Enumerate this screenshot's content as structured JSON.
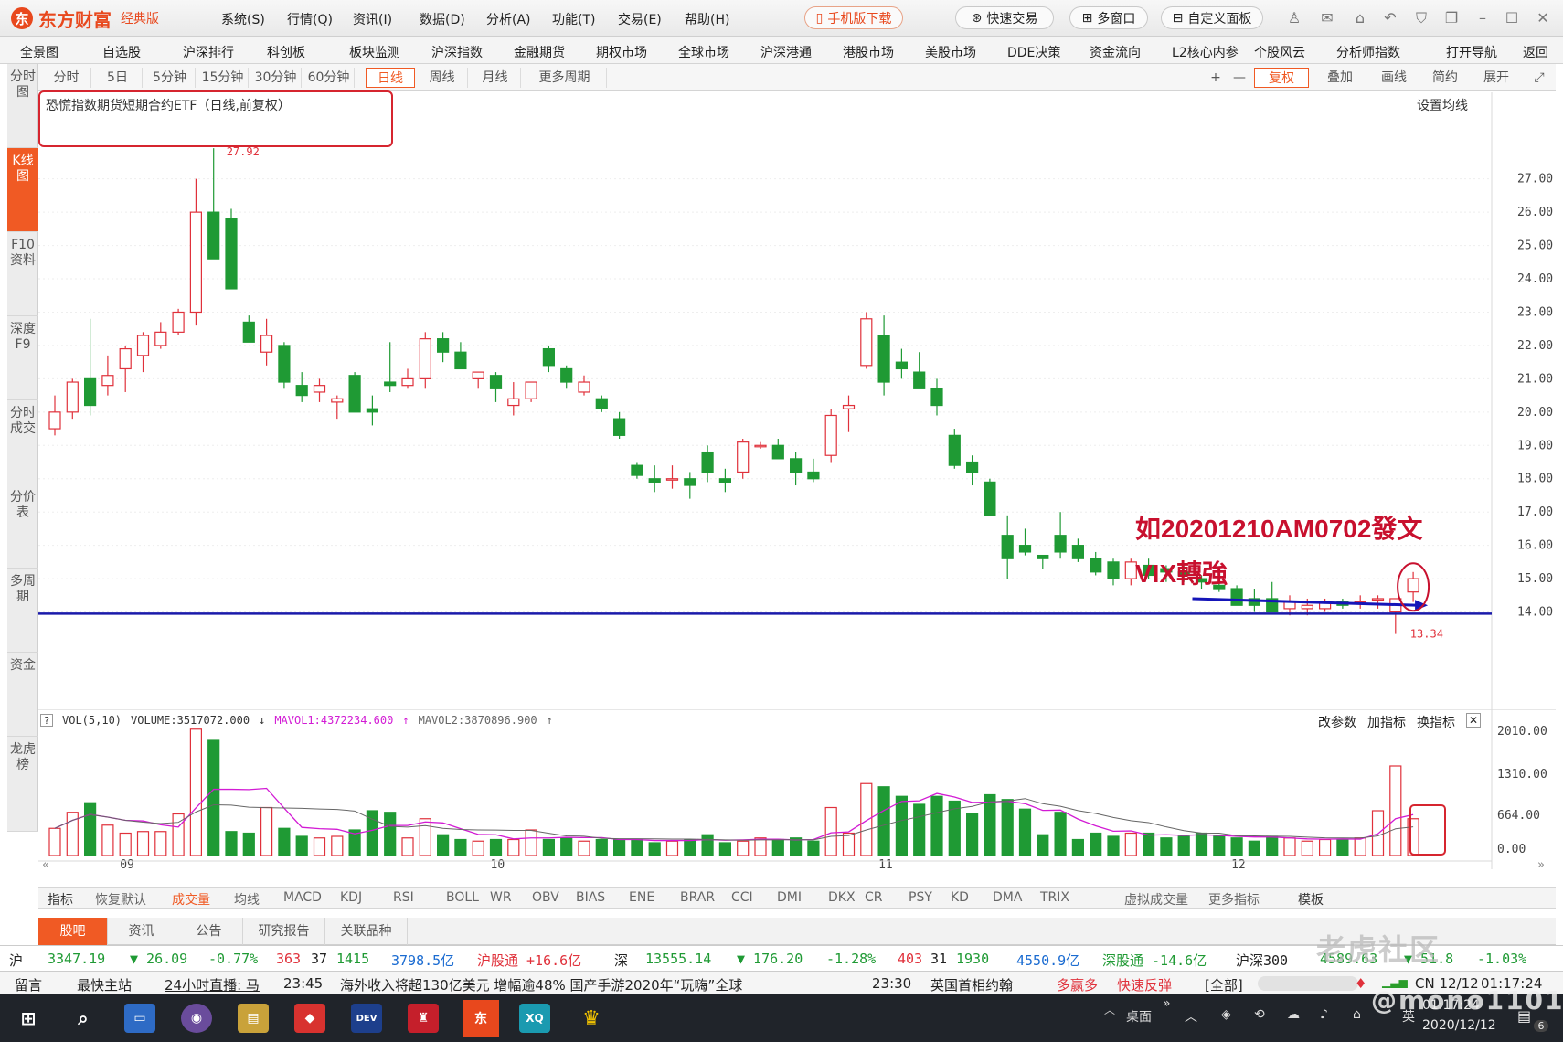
{
  "app": {
    "logo_mark": "东",
    "name": "东方财富",
    "edition": "经典版"
  },
  "menu": [
    "系统(S)",
    "行情(Q)",
    "资讯(I)",
    "数据(D)",
    "分析(A)",
    "功能(T)",
    "交易(E)",
    "帮助(H)"
  ],
  "top_buttons": {
    "mobile": "手机版下载",
    "fast_trade": "快速交易",
    "multi_window": "多窗口",
    "custom_panel": "自定义面板"
  },
  "nav": [
    "全景图",
    "自选股",
    "沪深排行",
    "科创板",
    "板块监测",
    "沪深指数",
    "金融期货",
    "期权市场",
    "全球市场",
    "沪深港通",
    "港股市场",
    "美股市场",
    "DDE决策",
    "资金流向",
    "L2核心内参",
    "个股风云",
    "分析师指数",
    "打开导航",
    "返回"
  ],
  "sidebar": [
    "分时图",
    "K线图",
    "F10资料",
    "深度F9",
    "分时成交",
    "分价表",
    "多周期",
    "资金",
    "龙虎榜"
  ],
  "periods": [
    "分时",
    "5日",
    "5分钟",
    "15分钟",
    "30分钟",
    "60分钟",
    "日线",
    "周线",
    "月线",
    "更多周期"
  ],
  "right_tools": {
    "plus": "+",
    "minus": "—",
    "fuquan": "复权",
    "overlay": "叠加",
    "draw": "画线",
    "simple": "简约",
    "expand": "展开"
  },
  "chart": {
    "title": "恐慌指数期货短期合约ETF（日线,前复权）",
    "ma_setting": "设置均线",
    "high_label": "27.92",
    "low_label": "13.34"
  },
  "annotation": {
    "line1": "如20201210AM0702發文",
    "line2": "VIX轉強"
  },
  "volume": {
    "label": "VOL(5,10)",
    "volume": "VOLUME:3517072.000",
    "mavol1": "MAVOL1:4372234.600",
    "mavol2": "MAVOL2:3870896.900",
    "tools": [
      "改参数",
      "加指标",
      "换指标"
    ]
  },
  "colors": {
    "up": "#e0313b",
    "down": "#1f9a34",
    "ma1": "#d21bd4",
    "ma2": "#666666",
    "support": "#1a1aaa",
    "trend": "#1515b8",
    "annot": "#c8102e",
    "accent": "#f05a24"
  },
  "chart_data": {
    "type": "candlestick",
    "y_ticks": [
      "27.00",
      "26.00",
      "25.00",
      "24.00",
      "23.00",
      "22.00",
      "21.00",
      "20.00",
      "19.00",
      "18.00",
      "17.00",
      "16.00",
      "15.00",
      "14.00"
    ],
    "ylim": [
      13.0,
      28.5
    ],
    "vol_ticks": [
      "2010.00",
      "1310.00",
      "664.00",
      "0.00"
    ],
    "vol_unit_note": "",
    "x_ticks": [
      "09",
      "10",
      "11",
      "12"
    ],
    "support_level": 13.95,
    "trend_line": {
      "from": [
        13.95,
        14.4
      ],
      "to": [
        13.95,
        14.2
      ]
    },
    "candles": [
      [
        19.5,
        20.5,
        19.3,
        20.0,
        170
      ],
      [
        20.0,
        21.0,
        19.8,
        20.9,
        270
      ],
      [
        21.0,
        22.8,
        19.9,
        20.2,
        330
      ],
      [
        20.8,
        21.7,
        20.5,
        21.1,
        190
      ],
      [
        21.3,
        22.0,
        20.6,
        21.9,
        140
      ],
      [
        21.7,
        22.4,
        21.2,
        22.3,
        150
      ],
      [
        22.0,
        22.7,
        21.9,
        22.4,
        150
      ],
      [
        22.4,
        23.1,
        22.3,
        23.0,
        260
      ],
      [
        23.0,
        27.0,
        22.6,
        26.0,
        790
      ],
      [
        26.0,
        27.92,
        24.6,
        24.6,
        720
      ],
      [
        25.8,
        26.1,
        23.9,
        23.7,
        150
      ],
      [
        22.7,
        22.9,
        22.2,
        22.1,
        140
      ],
      [
        21.8,
        22.8,
        21.4,
        22.3,
        300
      ],
      [
        22.0,
        22.1,
        20.7,
        20.9,
        170
      ],
      [
        20.8,
        21.2,
        20.3,
        20.5,
        120
      ],
      [
        20.6,
        21.0,
        20.3,
        20.8,
        110
      ],
      [
        20.3,
        20.5,
        19.8,
        20.4,
        120
      ],
      [
        21.1,
        21.2,
        20.0,
        20.0,
        160
      ],
      [
        20.1,
        20.5,
        19.6,
        20.0,
        280
      ],
      [
        20.9,
        22.1,
        20.6,
        20.8,
        270
      ],
      [
        20.8,
        21.3,
        20.7,
        21.0,
        110
      ],
      [
        21.0,
        22.4,
        20.7,
        22.2,
        230
      ],
      [
        22.2,
        22.4,
        21.5,
        21.8,
        130
      ],
      [
        21.8,
        22.1,
        21.3,
        21.3,
        100
      ],
      [
        21.0,
        21.2,
        20.7,
        21.2,
        90
      ],
      [
        21.1,
        21.2,
        20.3,
        20.7,
        100
      ],
      [
        20.2,
        20.9,
        19.9,
        20.4,
        100
      ],
      [
        20.4,
        20.9,
        20.3,
        20.9,
        160
      ],
      [
        21.9,
        22.0,
        21.2,
        21.4,
        100
      ],
      [
        21.3,
        21.4,
        20.7,
        20.9,
        110
      ],
      [
        20.6,
        21.1,
        20.5,
        20.9,
        90
      ],
      [
        20.4,
        20.5,
        20.0,
        20.1,
        100
      ],
      [
        19.8,
        20.0,
        19.2,
        19.3,
        100
      ],
      [
        18.4,
        18.5,
        18.0,
        18.1,
        100
      ],
      [
        18.0,
        18.4,
        17.6,
        17.9,
        80
      ],
      [
        18.0,
        18.4,
        17.7,
        18.0,
        90
      ],
      [
        18.0,
        18.2,
        17.4,
        17.8,
        100
      ],
      [
        18.8,
        19.0,
        17.9,
        18.2,
        130
      ],
      [
        18.0,
        18.3,
        17.6,
        17.9,
        80
      ],
      [
        18.2,
        19.2,
        18.0,
        19.1,
        90
      ],
      [
        19.0,
        19.1,
        18.9,
        19.0,
        110
      ],
      [
        19.0,
        19.2,
        18.6,
        18.6,
        100
      ],
      [
        18.6,
        18.8,
        17.8,
        18.2,
        110
      ],
      [
        18.2,
        18.6,
        17.9,
        18.0,
        90
      ],
      [
        18.7,
        20.1,
        18.5,
        19.9,
        300
      ],
      [
        20.1,
        20.5,
        19.4,
        20.2,
        140
      ],
      [
        21.4,
        23.0,
        21.3,
        22.8,
        450
      ],
      [
        22.3,
        22.9,
        20.5,
        20.9,
        430
      ],
      [
        21.5,
        21.9,
        21.0,
        21.3,
        370
      ],
      [
        21.2,
        21.8,
        20.7,
        20.7,
        320
      ],
      [
        20.7,
        21.0,
        19.9,
        20.2,
        370
      ],
      [
        19.3,
        19.5,
        18.3,
        18.4,
        340
      ],
      [
        18.5,
        18.7,
        17.8,
        18.2,
        260
      ],
      [
        17.9,
        18.0,
        16.9,
        16.9,
        380
      ],
      [
        16.3,
        16.9,
        15.0,
        15.6,
        350
      ],
      [
        16.0,
        16.5,
        15.7,
        15.8,
        290
      ],
      [
        15.7,
        15.7,
        15.3,
        15.6,
        130
      ],
      [
        16.3,
        17.0,
        15.6,
        15.8,
        270
      ],
      [
        16.0,
        16.2,
        15.5,
        15.6,
        100
      ],
      [
        15.6,
        15.8,
        15.1,
        15.2,
        140
      ],
      [
        15.5,
        15.6,
        14.8,
        15.0,
        120
      ],
      [
        15.0,
        15.6,
        14.8,
        15.5,
        140
      ],
      [
        15.4,
        15.6,
        15.0,
        15.1,
        140
      ],
      [
        15.3,
        15.4,
        14.9,
        15.2,
        110
      ],
      [
        15.2,
        15.4,
        14.9,
        15.1,
        120
      ],
      [
        15.0,
        15.1,
        14.7,
        14.9,
        140
      ],
      [
        14.8,
        15.0,
        14.6,
        14.7,
        120
      ],
      [
        14.7,
        14.8,
        14.2,
        14.2,
        110
      ],
      [
        14.4,
        14.7,
        14.0,
        14.2,
        90
      ],
      [
        14.4,
        14.9,
        14.1,
        14.0,
        120
      ],
      [
        14.1,
        14.5,
        13.9,
        14.3,
        110
      ],
      [
        14.1,
        14.4,
        13.9,
        14.2,
        90
      ],
      [
        14.1,
        14.4,
        14.0,
        14.3,
        100
      ],
      [
        14.3,
        14.4,
        14.1,
        14.2,
        100
      ],
      [
        14.3,
        14.5,
        14.1,
        14.3,
        110
      ],
      [
        14.4,
        14.5,
        14.1,
        14.4,
        280
      ],
      [
        14.0,
        14.2,
        13.34,
        14.4,
        560
      ],
      [
        14.6,
        15.2,
        14.3,
        15.0,
        230
      ]
    ]
  },
  "indicators": [
    "指标",
    "恢复默认",
    "成交量",
    "均线",
    "MACD",
    "KDJ",
    "RSI",
    "BOLL",
    "WR",
    "OBV",
    "BIAS",
    "ENE",
    "BRAR",
    "CCI",
    "DMI",
    "DKX",
    "CR",
    "PSY",
    "KD",
    "DMA",
    "TRIX",
    "虚拟成交量",
    "更多指标",
    "模板"
  ],
  "bottom_tabs": [
    "股吧",
    "资讯",
    "公告",
    "研究报告",
    "关联品种"
  ],
  "ticker": [
    "沪",
    "3347.19",
    "▼ 26.09",
    "-0.77%",
    "363",
    "37",
    "1415",
    "3798.5亿",
    "沪股通 +16.6亿",
    "深",
    "13555.14",
    "▼ 176.20",
    "-1.28%",
    "403",
    "31",
    "1930",
    "4550.9亿",
    "深股通 -14.6亿",
    "沪深300",
    "4589.63",
    "▼ 51.8",
    "-1.03%"
  ],
  "news": [
    "留言",
    "最快主站",
    "24小时直播: 马",
    "23:45",
    "海外收入将超130亿美元  增幅逾48%  国产手游2020年“玩嗨”全球",
    "23:30",
    "英国首相约翰",
    "多赢多",
    "快速反弹",
    "[全部]"
  ],
  "taskbar": {
    "desktop": "桌面",
    "lang": "英",
    "time": "01:17:24",
    "date": "2020/12/12",
    "cn": "CN 12/12",
    "badge": "6"
  },
  "watermark": {
    "site": "老虎社区",
    "user": "@mono1101"
  }
}
